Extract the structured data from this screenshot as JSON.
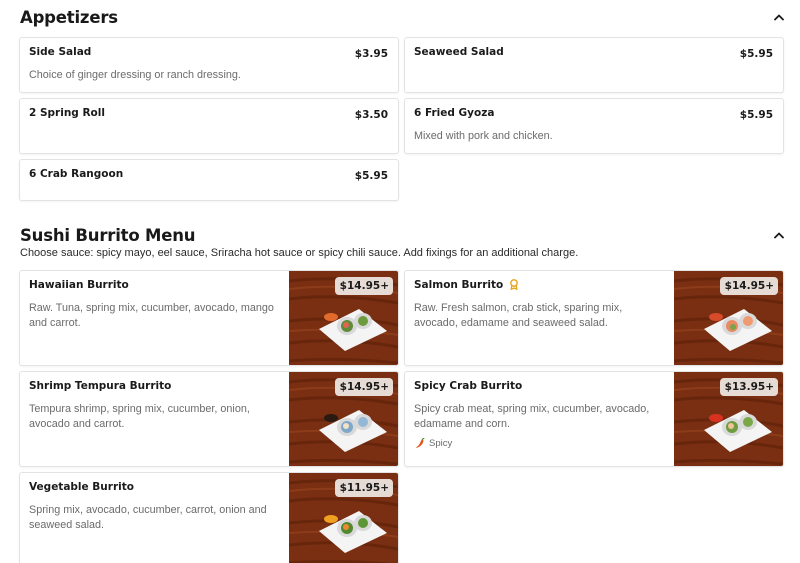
{
  "appetizers": {
    "title": "Appetizers",
    "items": [
      {
        "name": "Side Salad",
        "price": "$3.95",
        "description": "Choice of ginger dressing or ranch dressing."
      },
      {
        "name": "Seaweed Salad",
        "price": "$5.95",
        "description": ""
      },
      {
        "name": "2 Spring Roll",
        "price": "$3.50",
        "description": ""
      },
      {
        "name": "6 Fried Gyoza",
        "price": "$5.95",
        "description": "Mixed with pork and chicken."
      },
      {
        "name": "6 Crab Rangoon",
        "price": "$5.95",
        "description": ""
      }
    ]
  },
  "burritos": {
    "title": "Sushi Burrito Menu",
    "description": "Choose sauce: spicy mayo, eel sauce, Sriracha hot sauce or spicy chili sauce. Add fixings for an additional charge.",
    "items": [
      {
        "name": "Hawaiian Burrito",
        "price": "$14.95+",
        "description": "Raw. Tuna, spring mix, cucumber, avocado, mango and carrot."
      },
      {
        "name": "Salmon Burrito",
        "price": "$14.95+",
        "description": "Raw. Fresh salmon, crab stick, sparing mix, avocado, edamame and seaweed salad.",
        "badge_icon": "award-icon"
      },
      {
        "name": "Shrimp Tempura Burrito",
        "price": "$14.95+",
        "description": "Tempura shrimp, spring mix, cucumber, onion, avocado and carrot."
      },
      {
        "name": "Spicy Crab Burrito",
        "price": "$13.95+",
        "description": "Spicy crab meat, spring mix, cucumber, avocado, edamame and corn.",
        "tag": "Spicy",
        "tag_icon": "chili-pepper-icon"
      },
      {
        "name": "Vegetable Burrito",
        "price": "$11.95+",
        "description": "Spring mix, avocado, cucumber, carrot, onion and seaweed salad."
      }
    ]
  },
  "colors": {
    "text": "#1a1a1a",
    "muted": "#6b6b6b",
    "border": "#e3e3e3",
    "award": "#e8a317",
    "spicy": "#e8551c",
    "wood": "#7a2f12"
  }
}
